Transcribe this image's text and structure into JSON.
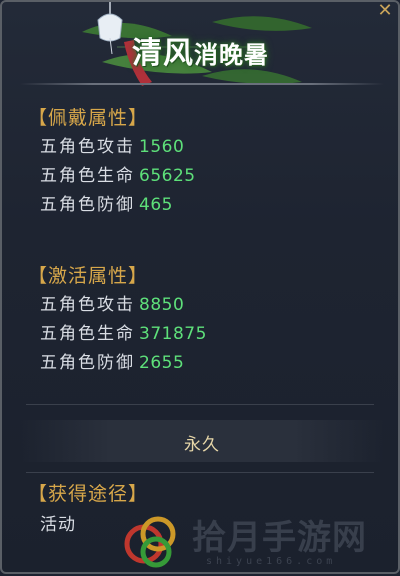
{
  "title": {
    "main": "清风",
    "small": "消晚暑"
  },
  "equip_section": {
    "heading": "【佩戴属性】",
    "rows": [
      {
        "name": "五角色攻击",
        "value": "1560"
      },
      {
        "name": "五角色生命",
        "value": "65625"
      },
      {
        "name": "五角色防御",
        "value": "465"
      }
    ]
  },
  "active_section": {
    "heading": "【激活属性】",
    "rows": [
      {
        "name": "五角色攻击",
        "value": "8850"
      },
      {
        "name": "五角色生命",
        "value": "371875"
      },
      {
        "name": "五角色防御",
        "value": "2655"
      }
    ]
  },
  "duration": "永久",
  "source_section": {
    "heading": "【获得途径】",
    "value": "活动"
  },
  "watermark": {
    "text": "拾月手游网",
    "sub": "shiyue166.com"
  },
  "colors": {
    "heading": "#d7a74a",
    "value_green": "#5ee07a",
    "text": "#d9dde4",
    "background": "#1e2431"
  },
  "icons": [
    "close-icon",
    "wind-chime-icon",
    "leaf-decoration-icon",
    "watermark-logo-icon"
  ]
}
